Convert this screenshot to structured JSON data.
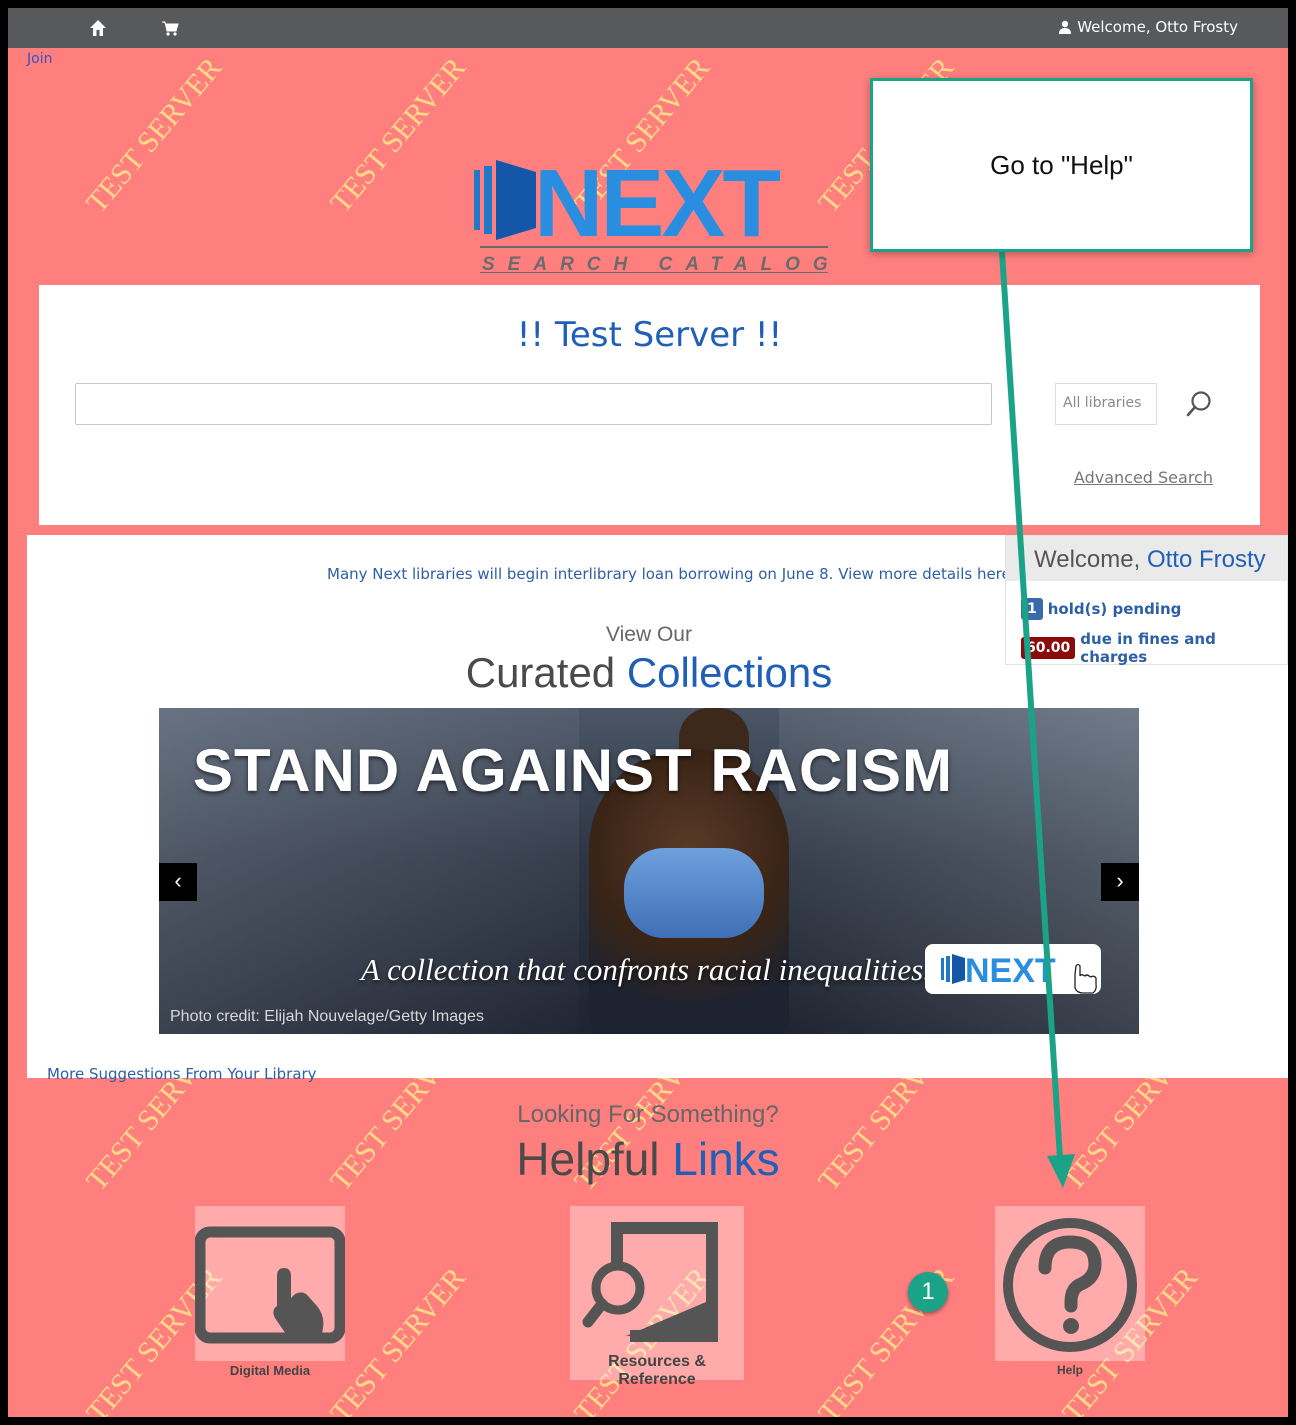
{
  "topbar": {
    "welcome": "Welcome, Otto Frosty",
    "join": "Join"
  },
  "watermark_text": "TEST SERVER",
  "logo": {
    "word": "NEXT",
    "tagline": "SEARCH CATALOG"
  },
  "search": {
    "title": "!! Test Server !!",
    "query": "",
    "library_select": "All libraries",
    "advanced_link": "Advanced Search"
  },
  "main": {
    "notice": "Many Next libraries will begin interlibrary loan borrowing on June 8. View more details here.",
    "view_our": "View Our",
    "curated_1": "Curated",
    "curated_2": "Collections",
    "slide": {
      "title": "STAND AGAINST RACISM",
      "tagline": "A collection that confronts racial inequalities.",
      "credit": "Photo credit: Elijah Nouvelage/Getty Images",
      "badge": "NEXT"
    },
    "prev": "‹",
    "next": "›",
    "more_suggestions": "More Suggestions From Your Library"
  },
  "sidebar": {
    "welcome_prefix": "Welcome,",
    "user_name": "Otto Frosty",
    "holds_count": "1",
    "holds_label": "hold(s) pending",
    "fines_amount": "60.00",
    "fines_label": "due in fines and charges"
  },
  "helpful": {
    "looking": "Looking For Something?",
    "helpful_1": "Helpful",
    "helpful_2": "Links",
    "links": [
      {
        "label": "Digital Media",
        "icon": "tablet-touch-icon"
      },
      {
        "label": "Resources & Reference",
        "icon": "search-picture-icon"
      },
      {
        "label": "Help",
        "icon": "question-circle-icon"
      }
    ]
  },
  "annotation": {
    "callout": "Go to \"Help\"",
    "step": "1"
  },
  "colors": {
    "page_bg": "#ff7f7f",
    "topbar": "#58595b",
    "accent_blue": "#1f5fb8",
    "annotation_green": "#1aa387",
    "fines_red": "#8b0c0c"
  }
}
